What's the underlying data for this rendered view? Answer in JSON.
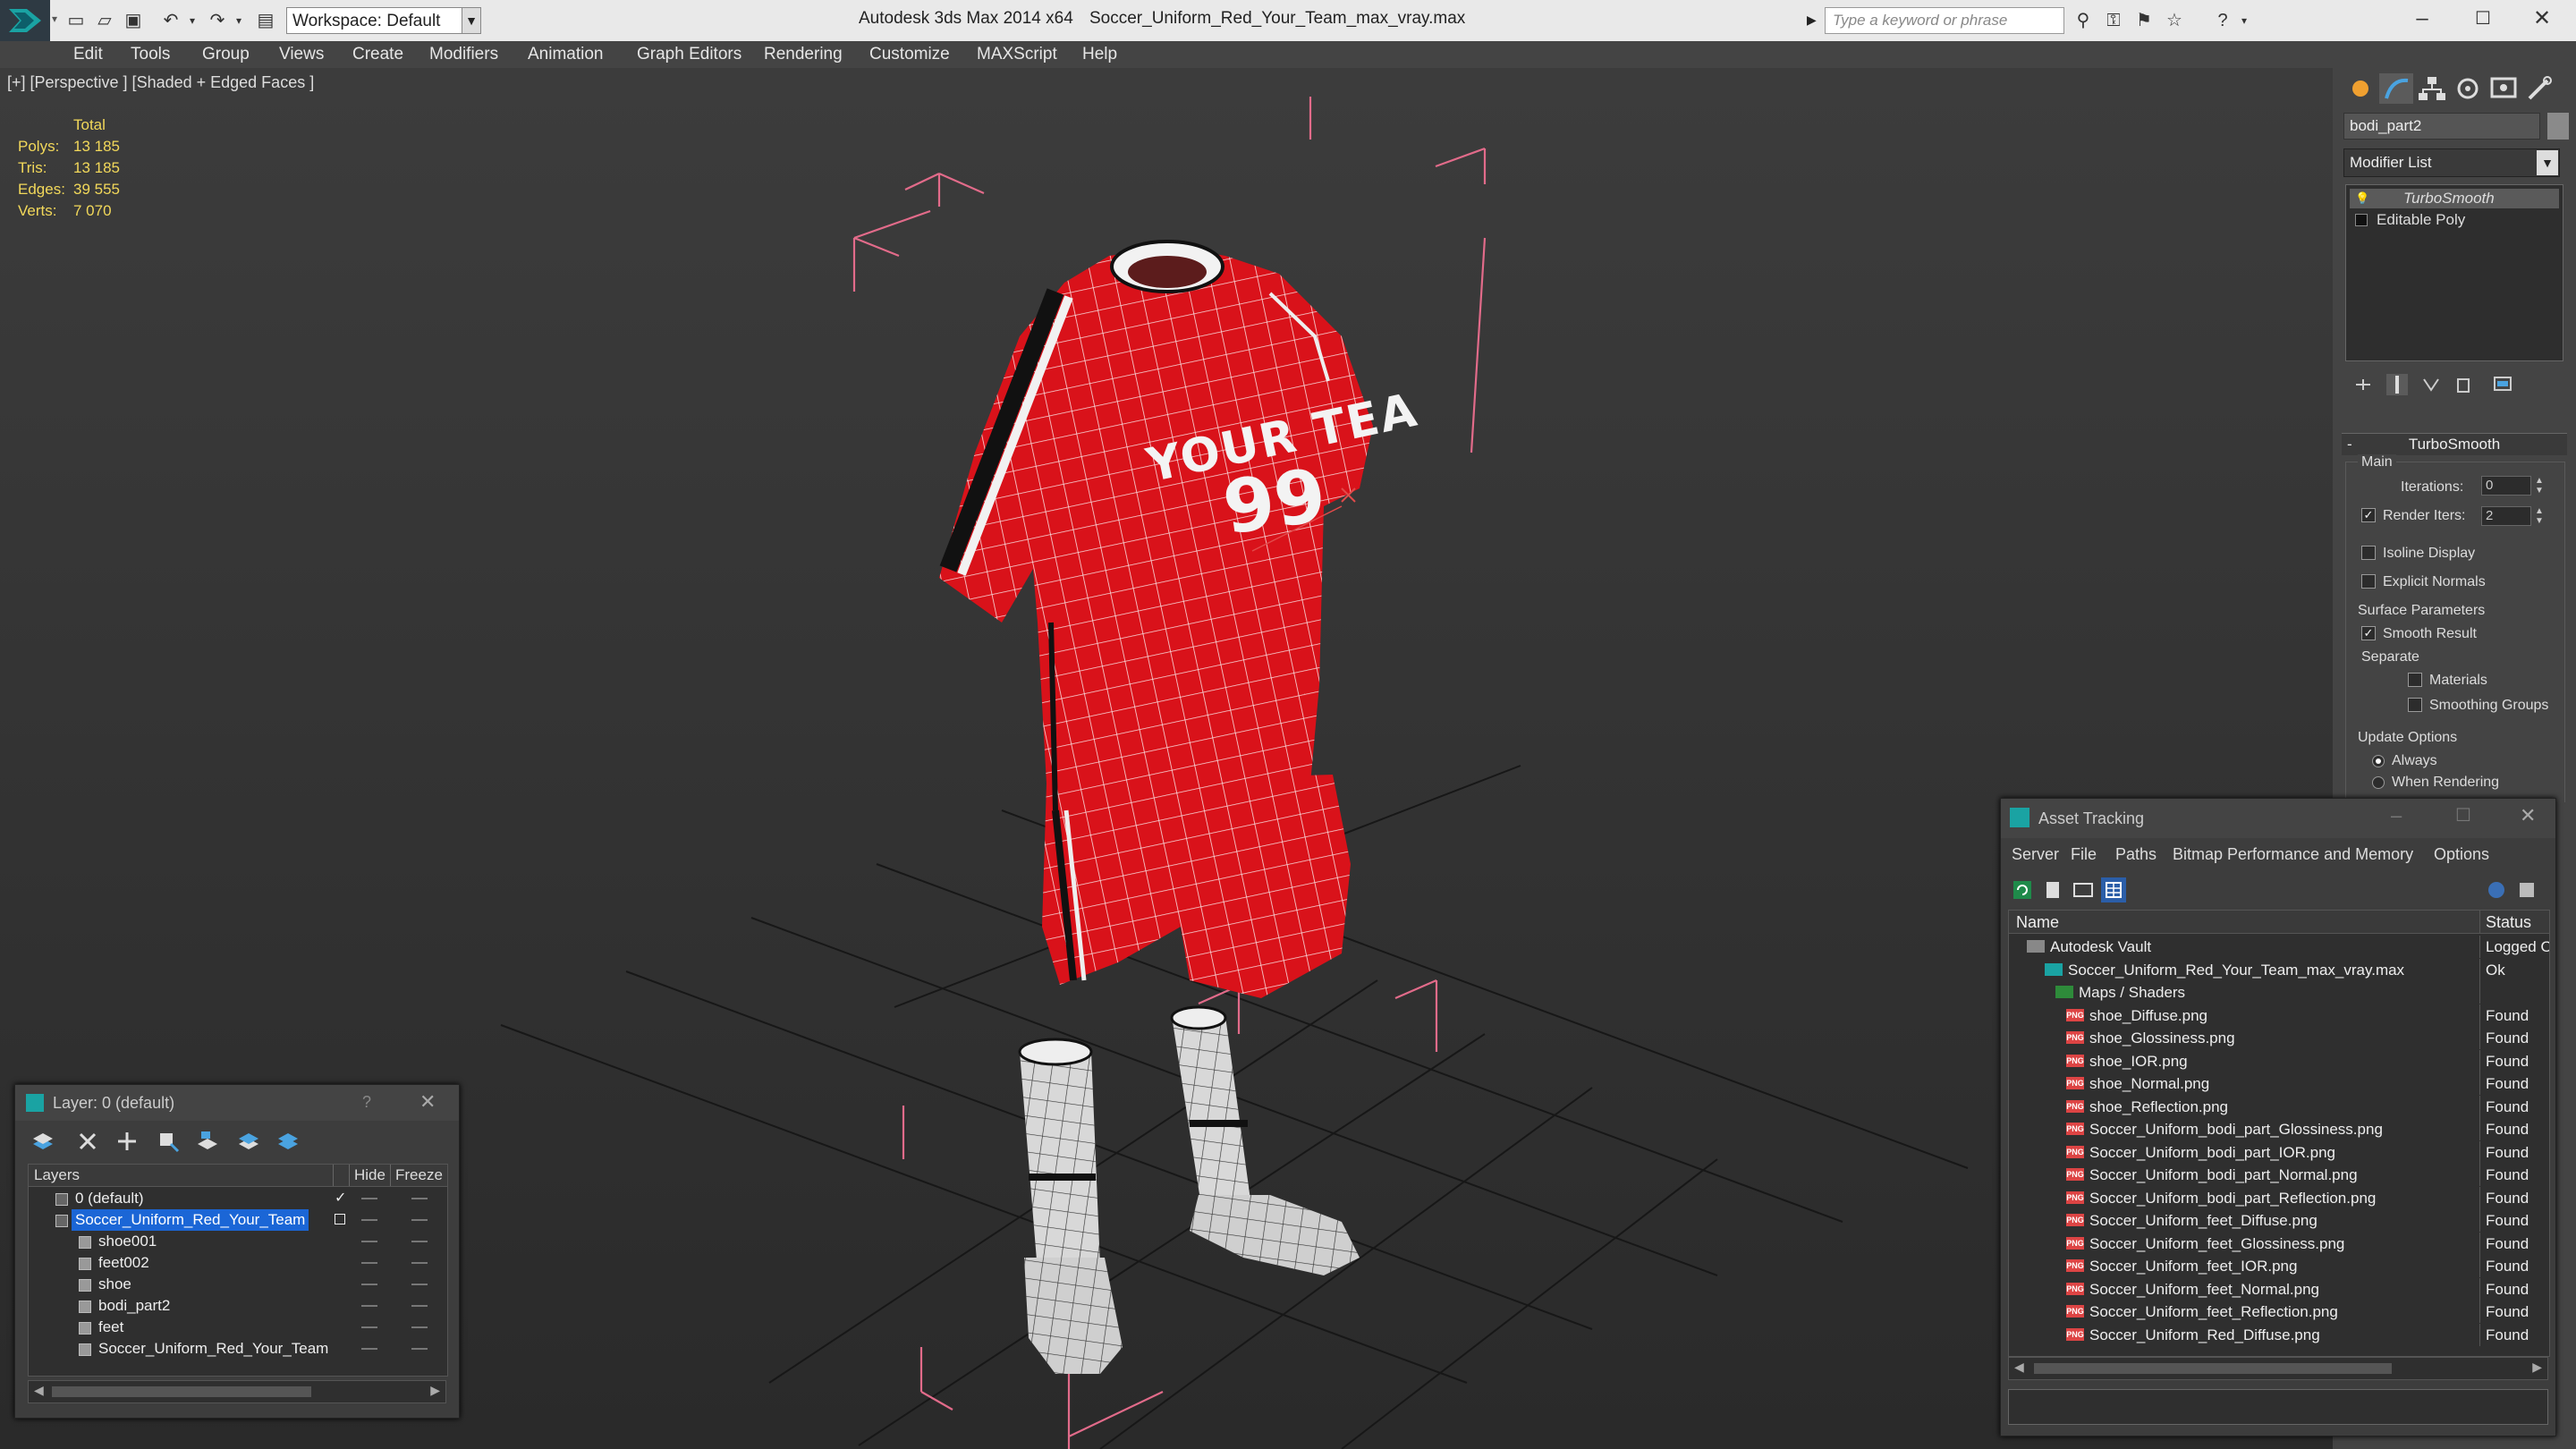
{
  "titlebar": {
    "workspace": "Workspace: Default",
    "app_title": "Autodesk 3ds Max  2014 x64",
    "document_title": "Soccer_Uniform_Red_Your_Team_max_vray.max",
    "search_placeholder": "Type a keyword or phrase"
  },
  "menu": [
    "Edit",
    "Tools",
    "Group",
    "Views",
    "Create",
    "Modifiers",
    "Animation",
    "Graph Editors",
    "Rendering",
    "Customize",
    "MAXScript",
    "Help"
  ],
  "viewport": {
    "label": "[+] [Perspective ] [Shaded + Edged Faces ]",
    "stats": {
      "header": "Total",
      "rows": [
        {
          "label": "Polys:",
          "value": "13 185"
        },
        {
          "label": "Tris:",
          "value": "13 185"
        },
        {
          "label": "Edges:",
          "value": "39 555"
        },
        {
          "label": "Verts:",
          "value": "7 070"
        }
      ]
    },
    "shirt_text": "YOUR TEA",
    "shirt_number": "99"
  },
  "command_panel": {
    "object_name": "bodi_part2",
    "modifier_list": "Modifier List",
    "stack": [
      "TurboSmooth",
      "Editable Poly"
    ],
    "rollout_title": "TurboSmooth",
    "main_group": "Main",
    "iterations_label": "Iterations:",
    "iterations_value": "0",
    "render_iters_label": "Render Iters:",
    "render_iters_value": "2",
    "isoline_display": "Isoline Display",
    "explicit_normals": "Explicit Normals",
    "surface_group": "Surface Parameters",
    "smooth_result": "Smooth Result",
    "separate": "Separate",
    "materials": "Materials",
    "smoothing_groups": "Smoothing Groups",
    "update_group": "Update Options",
    "always": "Always",
    "when_rendering": "When Rendering"
  },
  "asset_tracking": {
    "title": "Asset Tracking",
    "menu": [
      "Server",
      "File",
      "Paths",
      "Bitmap Performance and Memory",
      "Options"
    ],
    "columns": {
      "name": "Name",
      "status": "Status"
    },
    "rows": [
      {
        "name": "Autodesk Vault",
        "status": "Logged Out",
        "level": 0
      },
      {
        "name": "Soccer_Uniform_Red_Your_Team_max_vray.max",
        "status": "Ok",
        "level": 1
      },
      {
        "name": "Maps / Shaders",
        "status": "",
        "level": 2
      },
      {
        "name": "shoe_Diffuse.png",
        "status": "Found",
        "level": 3
      },
      {
        "name": "shoe_Glossiness.png",
        "status": "Found",
        "level": 3
      },
      {
        "name": "shoe_IOR.png",
        "status": "Found",
        "level": 3
      },
      {
        "name": "shoe_Normal.png",
        "status": "Found",
        "level": 3
      },
      {
        "name": "shoe_Reflection.png",
        "status": "Found",
        "level": 3
      },
      {
        "name": "Soccer_Uniform_bodi_part_Glossiness.png",
        "status": "Found",
        "level": 3
      },
      {
        "name": "Soccer_Uniform_bodi_part_IOR.png",
        "status": "Found",
        "level": 3
      },
      {
        "name": "Soccer_Uniform_bodi_part_Normal.png",
        "status": "Found",
        "level": 3
      },
      {
        "name": "Soccer_Uniform_bodi_part_Reflection.png",
        "status": "Found",
        "level": 3
      },
      {
        "name": "Soccer_Uniform_feet_Diffuse.png",
        "status": "Found",
        "level": 3
      },
      {
        "name": "Soccer_Uniform_feet_Glossiness.png",
        "status": "Found",
        "level": 3
      },
      {
        "name": "Soccer_Uniform_feet_IOR.png",
        "status": "Found",
        "level": 3
      },
      {
        "name": "Soccer_Uniform_feet_Normal.png",
        "status": "Found",
        "level": 3
      },
      {
        "name": "Soccer_Uniform_feet_Reflection.png",
        "status": "Found",
        "level": 3
      },
      {
        "name": "Soccer_Uniform_Red_Diffuse.png",
        "status": "Found",
        "level": 3
      }
    ]
  },
  "layer_window": {
    "title": "Layer: 0 (default)",
    "help": "?",
    "columns": {
      "layers": "Layers",
      "hide": "Hide",
      "freeze": "Freeze"
    },
    "rows": [
      {
        "name": "0 (default)",
        "level": 0,
        "selected": false
      },
      {
        "name": "Soccer_Uniform_Red_Your_Team",
        "level": 0,
        "selected": true
      },
      {
        "name": "shoe001",
        "level": 1,
        "selected": false
      },
      {
        "name": "feet002",
        "level": 1,
        "selected": false
      },
      {
        "name": "shoe",
        "level": 1,
        "selected": false
      },
      {
        "name": "bodi_part2",
        "level": 1,
        "selected": false
      },
      {
        "name": "feet",
        "level": 1,
        "selected": false
      },
      {
        "name": "Soccer_Uniform_Red_Your_Team",
        "level": 1,
        "selected": false
      }
    ]
  },
  "colors": {
    "accent_red": "#d9121a",
    "selection_blue": "#1b66d6",
    "stats_yellow": "#f2d85a",
    "bbox_pink": "#e26b8a"
  }
}
